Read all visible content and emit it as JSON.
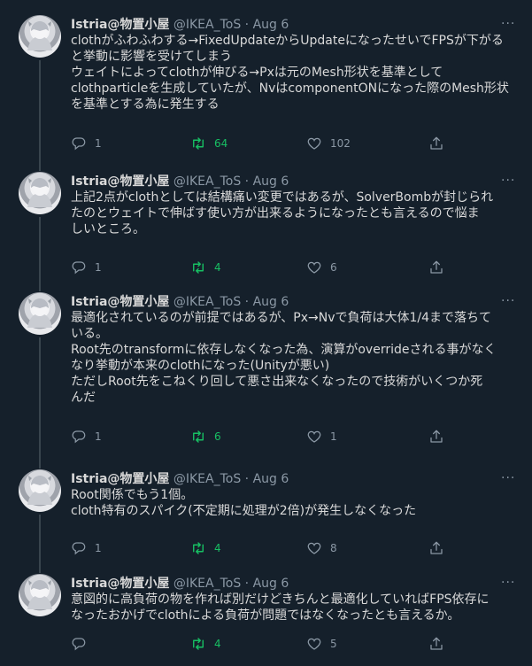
{
  "tweets": [
    {
      "name": "Istria@物置小屋",
      "handle": "@IKEA_ToS",
      "sep": "·",
      "date": "Aug 6",
      "lines": [
        "clothがふわふわする→FixedUpdateからUpdateになったせいでFPSが下がる",
        "と挙動に影響を受けてしまう",
        "ウェイトによってclothが伸びる→Pxは元のMesh形状を基準として",
        "clothparticleを生成していたが、NvはcomponentONになった際のMesh形状",
        "を基準とする為に発生する"
      ],
      "replies": "1",
      "retweets": "64",
      "likes": "102"
    },
    {
      "name": "Istria@物置小屋",
      "handle": "@IKEA_ToS",
      "sep": "·",
      "date": "Aug 6",
      "lines": [
        "上記2点がclothとしては結構痛い変更ではあるが、SolverBombが封じられ",
        "たのとウェイトで伸ばす使い方が出来るようになったとも言えるので悩ま",
        "しいところ。"
      ],
      "replies": "1",
      "retweets": "4",
      "likes": "6"
    },
    {
      "name": "Istria@物置小屋",
      "handle": "@IKEA_ToS",
      "sep": "·",
      "date": "Aug 6",
      "lines": [
        "最適化されているのが前提ではあるが、Px→Nvで負荷は大体1/4まで落ちて",
        "いる。",
        "Root先のtransformに依存しなくなった為、演算がoverrideされる事がなく",
        "なり挙動が本来のclothになった(Unityが悪い)",
        "ただしRoot先をこねくり回して悪さ出来なくなったので技術がいくつか死",
        "んだ"
      ],
      "replies": "1",
      "retweets": "6",
      "likes": "1"
    },
    {
      "name": "Istria@物置小屋",
      "handle": "@IKEA_ToS",
      "sep": "·",
      "date": "Aug 6",
      "lines": [
        "Root関係でもう1個。",
        "cloth特有のスパイク(不定期に処理が2倍)が発生しなくなった"
      ],
      "replies": "1",
      "retweets": "4",
      "likes": "8"
    },
    {
      "name": "Istria@物置小屋",
      "handle": "@IKEA_ToS",
      "sep": "·",
      "date": "Aug 6",
      "lines": [
        "意図的に高負荷の物を作れば別だけどきちんと最適化していればFPS依存に",
        "なったおかげでclothによる負荷が問題ではなくなったとも言えるか。"
      ],
      "replies": "",
      "retweets": "4",
      "likes": "5"
    }
  ],
  "colors": {
    "background": "#15202b",
    "text": "#d9d9d9",
    "muted": "#8b98a5",
    "retweet": "#17bf63",
    "thread_line": "#38444d"
  },
  "icons": {
    "reply": "reply-icon",
    "retweet": "retweet-icon",
    "like": "heart-icon",
    "share": "share-icon",
    "more": "more-icon"
  }
}
